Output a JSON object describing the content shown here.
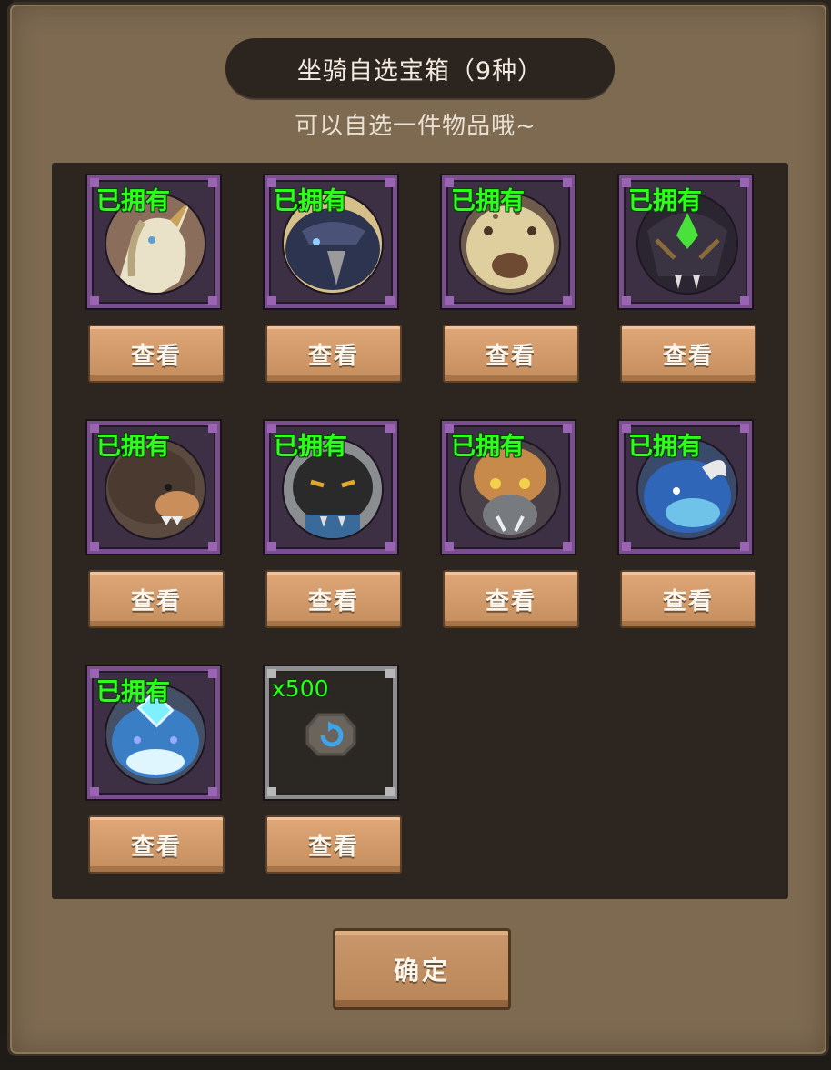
{
  "dialog": {
    "title": "坐骑自选宝箱（9种）",
    "subtitle": "可以自选一件物品哦~",
    "confirm_label": "确定"
  },
  "items": [
    {
      "owned_label": "已拥有",
      "view_label": "查看",
      "creature": "unicorn",
      "colors": [
        "#e9e2c9",
        "#b8a77e"
      ]
    },
    {
      "owned_label": "已拥有",
      "view_label": "查看",
      "creature": "dark-bird",
      "colors": [
        "#2c3450",
        "#4a5278"
      ]
    },
    {
      "owned_label": "已拥有",
      "view_label": "查看",
      "creature": "hyena",
      "colors": [
        "#e0cf9e",
        "#6e4a33"
      ]
    },
    {
      "owned_label": "已拥有",
      "view_label": "查看",
      "creature": "armored-beast",
      "colors": [
        "#3a3342",
        "#49e23a"
      ]
    },
    {
      "owned_label": "已拥有",
      "view_label": "查看",
      "creature": "boar",
      "colors": [
        "#4b3a30",
        "#c98e5a"
      ]
    },
    {
      "owned_label": "已拥有",
      "view_label": "查看",
      "creature": "black-panther",
      "colors": [
        "#2a2a2a",
        "#e0a72a"
      ]
    },
    {
      "owned_label": "已拥有",
      "view_label": "查看",
      "creature": "warthog",
      "colors": [
        "#c88a4a",
        "#777b80"
      ]
    },
    {
      "owned_label": "已拥有",
      "view_label": "查看",
      "creature": "blue-rhino",
      "colors": [
        "#2f66b8",
        "#6fc3e8"
      ]
    },
    {
      "owned_label": "已拥有",
      "view_label": "查看",
      "creature": "ice-wolf",
      "colors": [
        "#3a7fc6",
        "#dff6ff"
      ]
    },
    {
      "qty_label": "x500",
      "view_label": "查看",
      "creature": "reroll-token",
      "colors": [
        "#55504a",
        "#3ea4e8"
      ]
    }
  ]
}
